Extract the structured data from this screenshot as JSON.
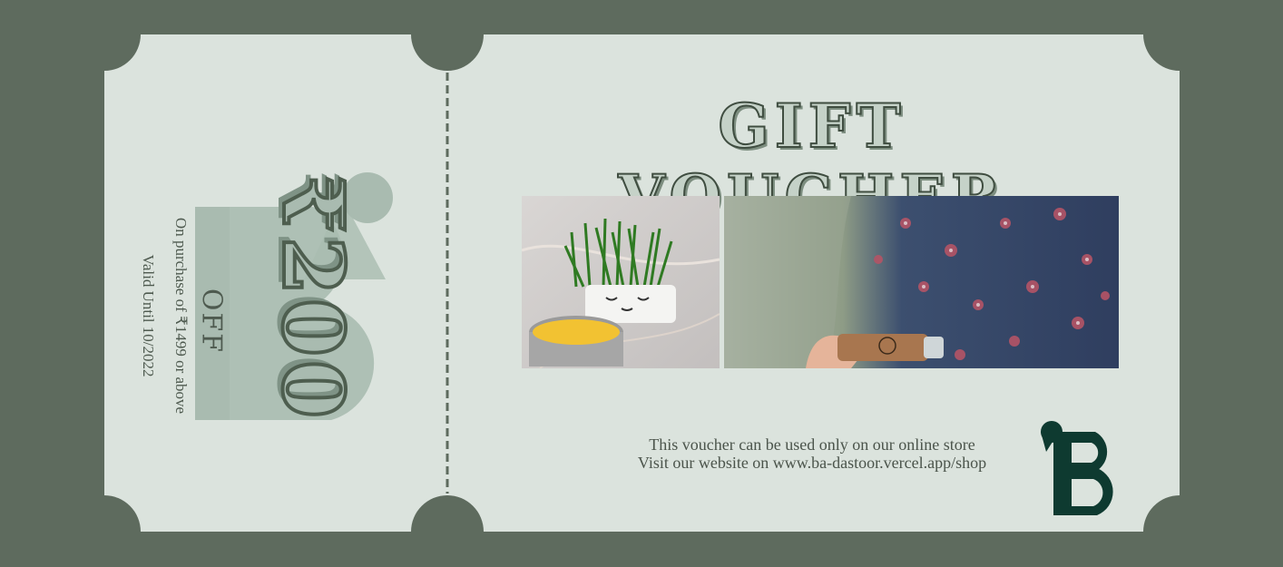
{
  "voucher": {
    "title": "GIFT VOUCHER",
    "amount": "₹200",
    "off_label": "OFF",
    "condition": "On purchase of ₹1499 or above",
    "validity": "Valid Until 10/2022",
    "usage_note": "This voucher can be used only on our online store",
    "website_note": "Visit our website on www.ba-dastoor.vercel.app/shop",
    "logo_mark": "B"
  },
  "colors": {
    "page_background": "#5e6b5e",
    "ticket_background": "#dbe3dd",
    "accent_dark": "#0e3a30",
    "text": "#4b544b"
  },
  "icons": [
    "brand-logo-icon",
    "perforation-line"
  ]
}
